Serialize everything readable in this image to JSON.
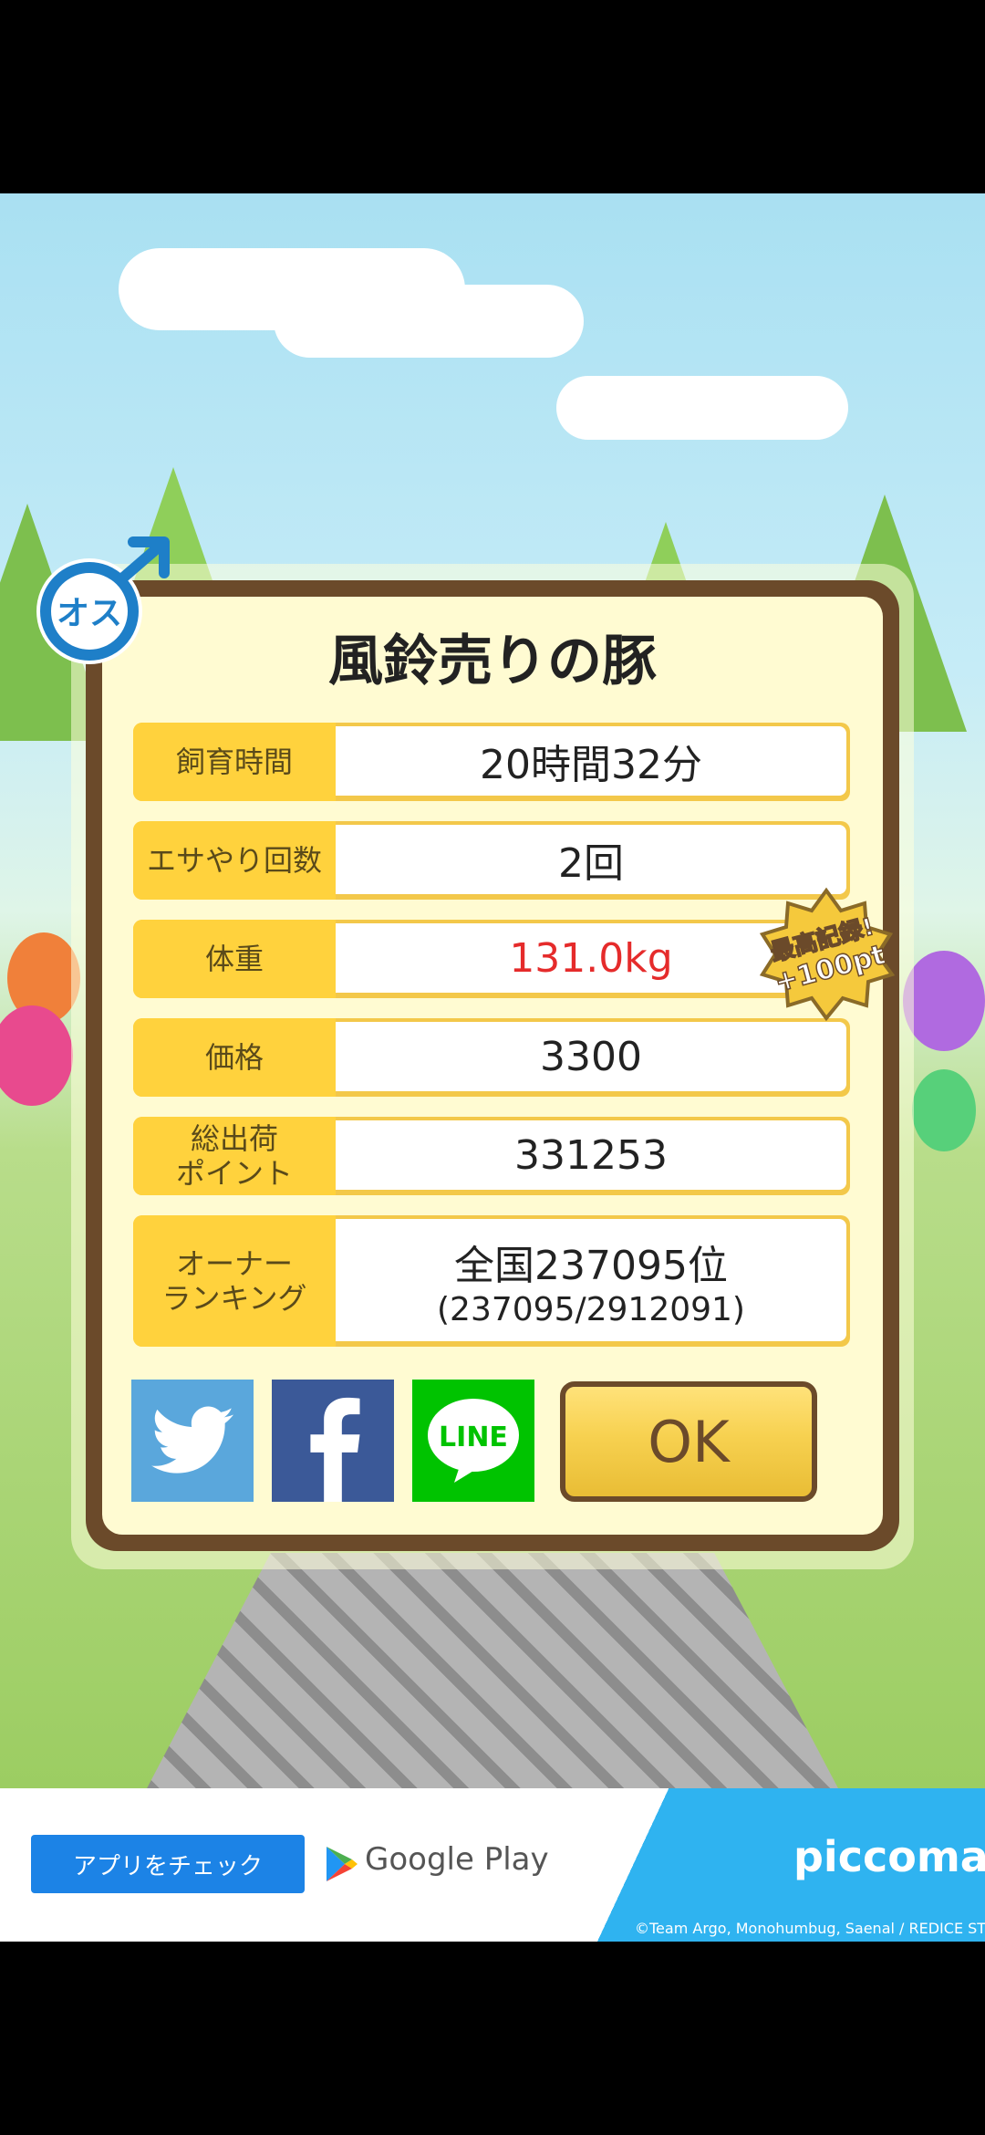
{
  "dialog": {
    "title": "風鈴売りの豚",
    "rows": [
      {
        "label": "飼育時間",
        "value": "20時間32分"
      },
      {
        "label": "エサやり回数",
        "value": "2回"
      },
      {
        "label": "体重",
        "value": "131.0kg",
        "value_color": "#e52b2b"
      },
      {
        "label": "価格",
        "value": "3300"
      },
      {
        "label": "総出荷\nポイント",
        "value": "331253"
      },
      {
        "label": "オーナー\nランキング",
        "value": "全国237095位",
        "value_sub": "(237095/2912091)"
      }
    ],
    "record_badge": {
      "line1": "最高記録!",
      "line2": "+100pt"
    },
    "gender_badge": {
      "text": "オス",
      "icon": "male-symbol-icon"
    },
    "share_buttons": [
      {
        "name": "twitter",
        "icon": "twitter-bird-icon",
        "color": "#5aa7dc"
      },
      {
        "name": "facebook",
        "icon": "facebook-f-icon",
        "color": "#3b5998"
      },
      {
        "name": "line",
        "icon": "line-icon",
        "label": "LINE",
        "color": "#00c300"
      }
    ],
    "ok_label": "OK"
  },
  "ad": {
    "button_label": "アプリをチェック",
    "store_label": "Google Play",
    "brand": "piccoma",
    "credit": "©Team Argo, Monohumbug, Saenal / REDICE STUDIO"
  }
}
